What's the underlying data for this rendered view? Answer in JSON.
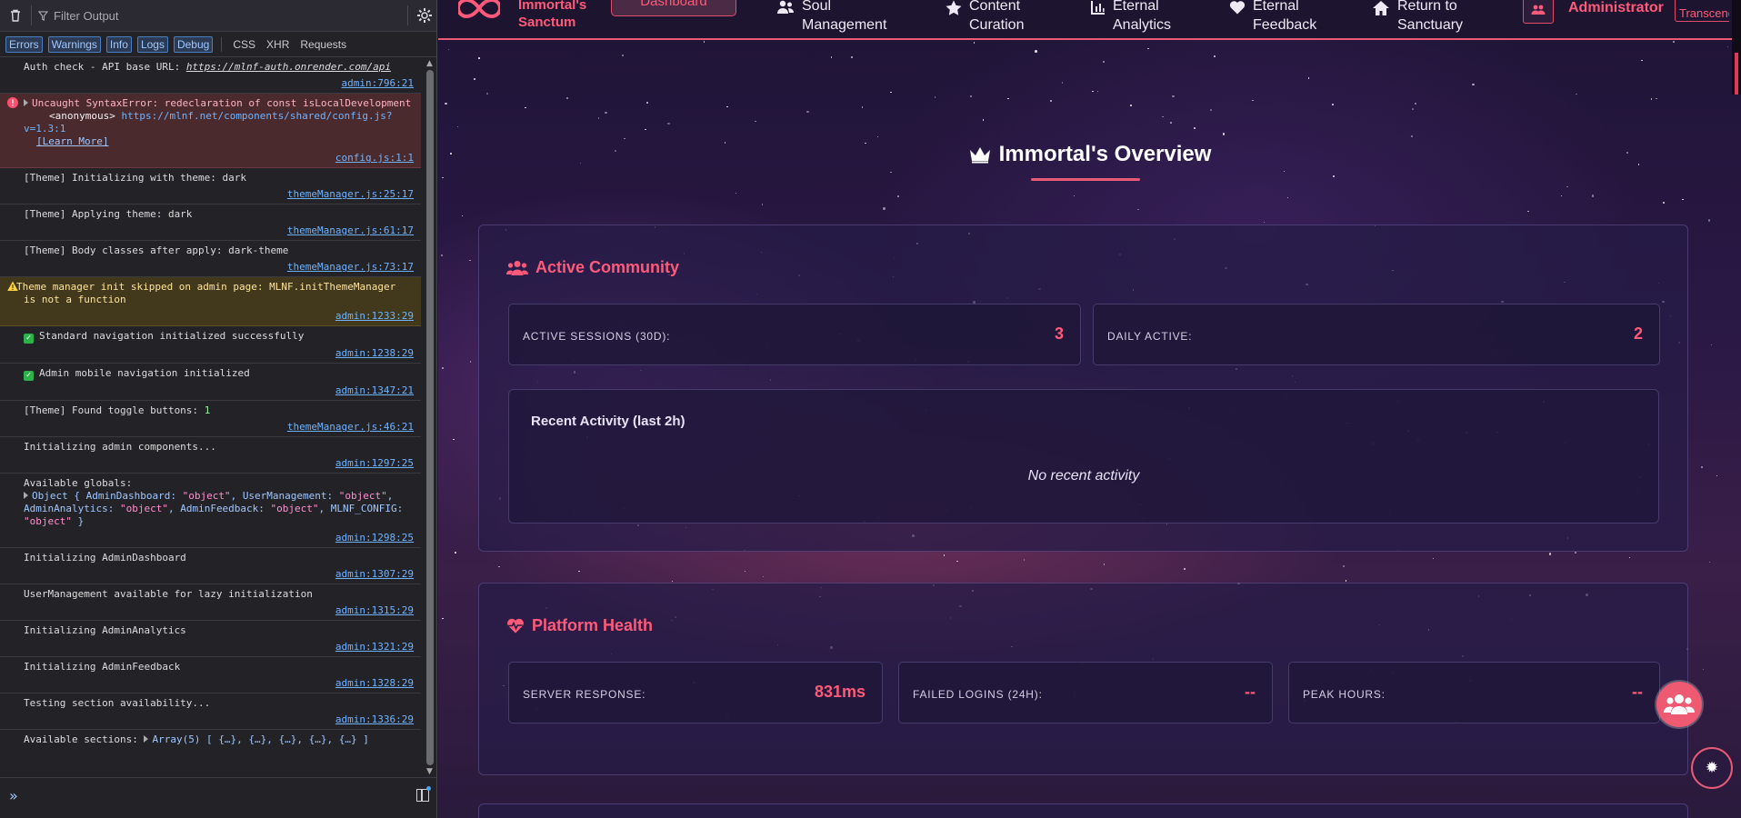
{
  "console": {
    "toolbar": {
      "filter_placeholder": "Filter Output"
    },
    "filters": {
      "active": [
        "Errors",
        "Warnings",
        "Info",
        "Logs",
        "Debug"
      ],
      "extra": [
        "CSS",
        "XHR",
        "Requests"
      ]
    },
    "messages": [
      {
        "type": "log",
        "text": "Auth check - API base URL: ",
        "link": "https://mlnf-auth.onrender.com/api",
        "source": "admin:796:21"
      },
      {
        "type": "error",
        "text": "Uncaught SyntaxError: redeclaration of const isLocalDevelopment",
        "sub_prefix": "<anonymous>",
        "sub_url": "https://mlnf.net/components/shared/config.js?v=1.3:1",
        "learn_more": "[Learn More]",
        "source": "config.js:1:1"
      },
      {
        "type": "log",
        "text": "[Theme] Initializing with theme: dark",
        "source": "themeManager.js:25:17"
      },
      {
        "type": "log",
        "text": "[Theme] Applying theme: dark",
        "source": "themeManager.js:61:17"
      },
      {
        "type": "log",
        "text": "[Theme] Body classes after apply: dark-theme",
        "source": "themeManager.js:73:17"
      },
      {
        "type": "warn",
        "text": "Theme manager init skipped on admin page: MLNF.initThemeManager is not a function",
        "source": "admin:1233:29"
      },
      {
        "type": "check",
        "text": "Standard navigation initialized successfully",
        "source": "admin:1238:29"
      },
      {
        "type": "check",
        "text": "Admin mobile navigation initialized",
        "source": "admin:1347:21"
      },
      {
        "type": "log",
        "text": "[Theme] Found toggle buttons: ",
        "num": "1",
        "source": "themeManager.js:46:21"
      },
      {
        "type": "log",
        "text": "Initializing admin components...",
        "source": "admin:1297:25"
      },
      {
        "type": "log",
        "text": "Available globals:",
        "source": "admin:1298:25"
      },
      {
        "type": "log",
        "text": "Initializing AdminDashboard",
        "source": "admin:1307:29"
      },
      {
        "type": "log",
        "text": "UserManagement available for lazy initialization",
        "source": "admin:1315:29"
      },
      {
        "type": "log",
        "text": "Initializing AdminAnalytics",
        "source": "admin:1321:29"
      },
      {
        "type": "log",
        "text": "Initializing AdminFeedback",
        "source": "admin:1328:29"
      },
      {
        "type": "log",
        "text": "Testing section availability...",
        "source": "admin:1336:29"
      },
      {
        "type": "log",
        "text": "Available sections: ",
        "source": ""
      }
    ],
    "globals_object": {
      "prefix": "Object { ",
      "pairs": [
        {
          "key": "AdminDashboard: ",
          "val": "\"object\""
        },
        {
          "key": "UserManagement: ",
          "val": "\"object\""
        },
        {
          "key": "AdminAnalytics: ",
          "val": "\"object\""
        },
        {
          "key": "AdminFeedback: ",
          "val": "\"object\""
        },
        {
          "key": "MLNF_CONFIG: ",
          "val": "\"object\""
        }
      ],
      "suffix": " }"
    },
    "sections_array": "Array(5) [ {…}, {…}, {…}, {…}, {…} ]",
    "prompt": "»"
  },
  "page": {
    "brand": {
      "line1": "Immortal's",
      "line2": "Sanctum"
    },
    "dashboard_tab": "Dashboard",
    "nav": [
      {
        "line1": "Soul",
        "line2": "Management",
        "icon": "users-icon"
      },
      {
        "line1": "Content",
        "line2": "Curation",
        "icon": "star-icon"
      },
      {
        "line1": "Eternal",
        "line2": "Analytics",
        "icon": "chart-icon"
      },
      {
        "line1": "Eternal",
        "line2": "Feedback",
        "icon": "heart-icon"
      },
      {
        "line1": "Return to",
        "line2": "Sanctuary",
        "icon": "home-icon"
      }
    ],
    "admin_label": "Administrator",
    "transcend_label": "Transcend",
    "headline": "Immortal's Overview",
    "community": {
      "title": "Active Community",
      "stats": [
        {
          "label": "Active Sessions (30d):",
          "value": "3"
        },
        {
          "label": "Daily Active:",
          "value": "2"
        }
      ],
      "recent_title": "Recent Activity (last 2h)",
      "recent_empty": "No recent activity"
    },
    "health": {
      "title": "Platform Health",
      "stats": [
        {
          "label": "Server Response:",
          "value": "831ms"
        },
        {
          "label": "Failed Logins (24h):",
          "value": "--"
        },
        {
          "label": "Peak Hours:",
          "value": "--"
        }
      ]
    },
    "colors": {
      "accent": "#ff5a79",
      "background": "#2a1845",
      "console_bg": "#232327"
    }
  }
}
